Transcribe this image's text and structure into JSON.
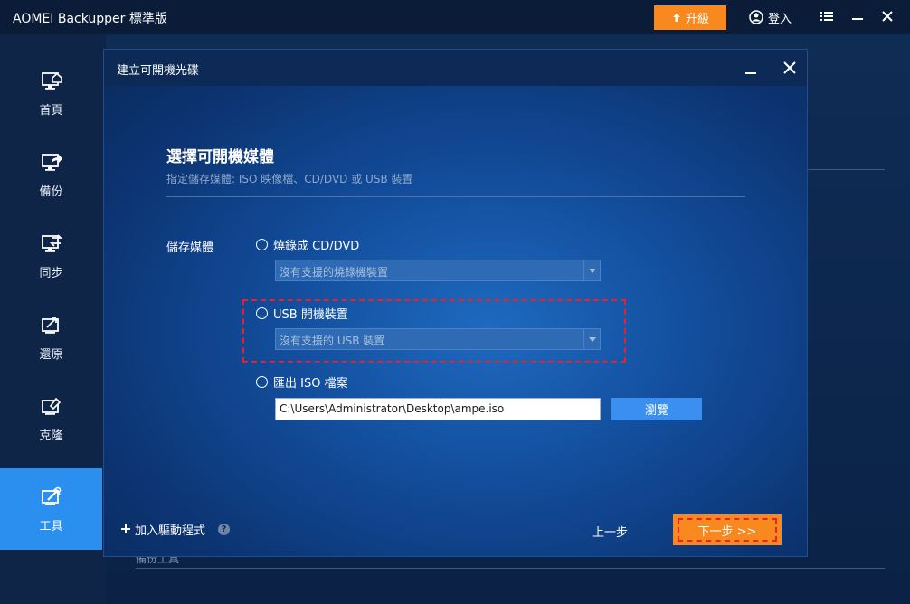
{
  "app": {
    "title": "AOMEI Backupper 標準版",
    "upgrade_label": "升級",
    "login_label": "登入"
  },
  "sidebar": {
    "items": [
      {
        "label": "首頁",
        "icon": "home-icon"
      },
      {
        "label": "備份",
        "icon": "backup-icon"
      },
      {
        "label": "同步",
        "icon": "sync-icon"
      },
      {
        "label": "還原",
        "icon": "restore-icon"
      },
      {
        "label": "克隆",
        "icon": "clone-icon"
      },
      {
        "label": "工具",
        "icon": "tools-icon",
        "active": true
      }
    ]
  },
  "background": {
    "partial_text": "備份工具"
  },
  "dialog": {
    "title": "建立可開機光碟",
    "heading": "選擇可開機媒體",
    "subheading": "指定儲存媒體: ISO 映像檔、CD/DVD 或 USB 裝置",
    "storage_label": "儲存媒體",
    "options": {
      "cd": {
        "label": "燒錄成 CD/DVD",
        "select_value": "沒有支援的燒錄機裝置"
      },
      "usb": {
        "label": "USB 開機裝置",
        "select_value": "沒有支援的 USB 裝置"
      },
      "iso": {
        "label": "匯出 ISO 檔案",
        "path_value": "C:\\Users\\Administrator\\Desktop\\ampe.iso"
      }
    },
    "browse_label": "瀏覽",
    "add_driver_label": "加入驅動程式",
    "help_glyph": "?",
    "prev_label": "上一步",
    "next_label": "下一步 >>"
  },
  "colors": {
    "accent_orange": "#f7891f",
    "accent_blue": "#2b8ff0",
    "highlight_red": "#e8222a"
  }
}
